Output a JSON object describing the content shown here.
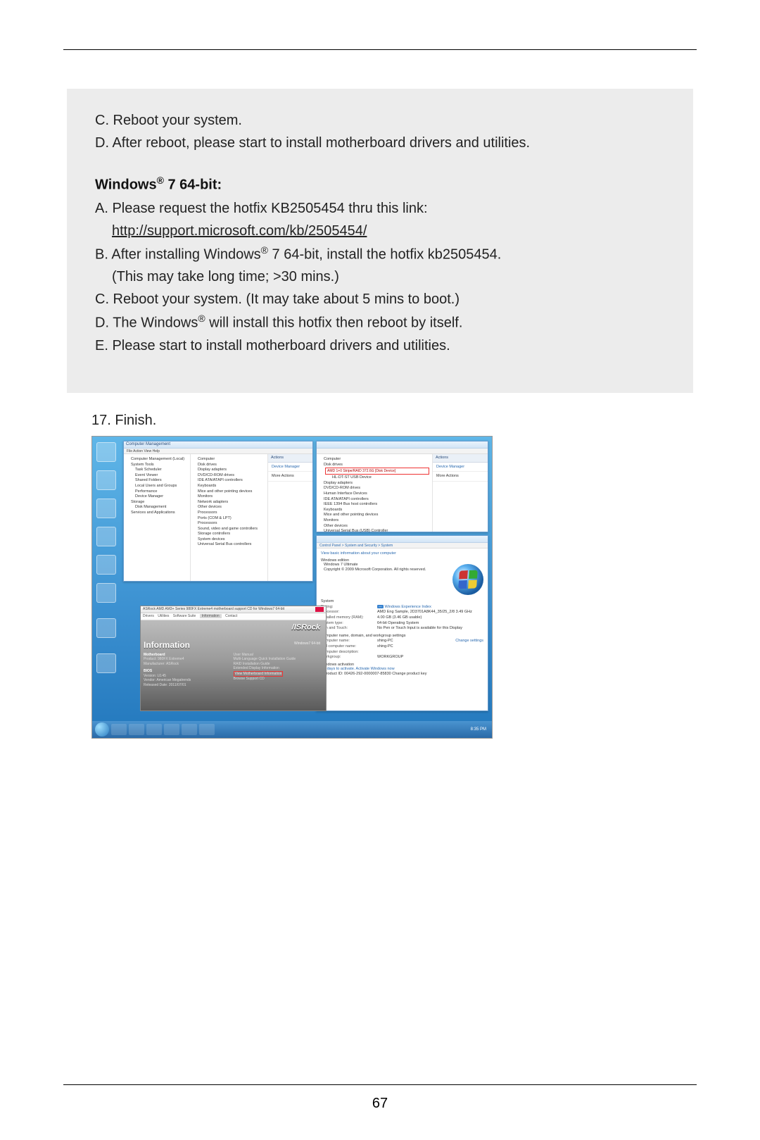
{
  "top_section": {
    "lineC": "C. Reboot your system.",
    "lineD": "D. After reboot, please start to install motherboard drivers and utilities."
  },
  "win64": {
    "heading_pre": "Windows",
    "heading_post": " 7 64-bit:",
    "A_pre": "A. Please request the hotfix KB2505454 thru this link:",
    "A_link": "http://support.microsoft.com/kb/2505454/",
    "B_pre": "B. After installing Windows",
    "B_post": " 7 64-bit, install the hotfix kb2505454.",
    "B_note": "(This may take long time; >30 mins.)",
    "C": "C. Reboot your system. (It may take about 5 mins to boot.)",
    "D_pre": "D. The Windows",
    "D_post": " will install this hotfix then reboot by itself.",
    "E": "E. Please start to install motherboard drivers and utilities."
  },
  "step17": "17. Finish.",
  "page_number": "67",
  "screenshot": {
    "taskbar_clock": "8:35 PM",
    "cm_window": {
      "title": "Computer Management",
      "menubar": "File  Action  View  Help",
      "left_tree": [
        "Computer Management (Local)",
        "System Tools",
        "Task Scheduler",
        "Event Viewer",
        "Shared Folders",
        "Local Users and Groups",
        "Performance",
        "Device Manager",
        "Storage",
        "Disk Management",
        "Services and Applications"
      ],
      "mid_tree": [
        "Computer",
        "Disk drives",
        "Display adapters",
        "DVD/CD-ROM drives",
        "IDE ATA/ATAPI controllers",
        "Keyboards",
        "Mice and other pointing devices",
        "Monitors",
        "Network adapters",
        "Other devices",
        "Processors",
        "Ports (COM & LPT)",
        "Processors",
        "Sound, video and game controllers",
        "Storage controllers",
        "System devices",
        "Universal Serial Bus controllers"
      ],
      "actions": "Actions",
      "actions_sub": "Device Manager",
      "actions_more": "More Actions"
    },
    "dm_window": {
      "mid_tree": [
        "Computer",
        "Disk drives",
        "AMD 1+0 Stripe/RAID 372.6G [Disk Device]",
        "HL-DT-ST USB Device",
        "Display adapters",
        "DVD/CD-ROM drives",
        "Human Interface Devices",
        "IDE ATA/ATAPI controllers",
        "IEEE 1394 Bus host controllers",
        "Keyboards",
        "Mice and other pointing devices",
        "Monitors",
        "Other devices",
        "Universal Serial Bus (USB) Controller"
      ],
      "actions": "Actions",
      "actions_sub": "Device Manager",
      "actions_more": "More Actions"
    },
    "sys_window": {
      "breadcrumb": "Control Panel > System and Security > System",
      "view_label": "View basic information about your computer",
      "edition_h": "Windows edition",
      "edition": "Windows 7 Ultimate",
      "copyright": "Copyright © 2009 Microsoft Corporation. All rights reserved.",
      "system_h": "System",
      "rating_k": "Rating:",
      "rating_v": "Windows Experience Index",
      "processor_k": "Processor:",
      "processor_v": "AMD Eng Sample, 2D3701A8K44_35/25_2/8    3.49 GHz",
      "ram_k": "Installed memory (RAM):",
      "ram_v": "4.00 GB (3.46 GB usable)",
      "systype_k": "System type:",
      "systype_v": "64-bit Operating System",
      "pen_k": "Pen and Touch:",
      "pen_v": "No Pen or Touch Input is available for this Display",
      "cname_h": "Computer name, domain, and workgroup settings",
      "cname_k": "Computer name:",
      "cname_v": "shing-PC",
      "change": "Change settings",
      "fname_k": "Full computer name:",
      "fname_v": "shing-PC",
      "desc_k": "Computer description:",
      "wg_k": "Workgroup:",
      "wg_v": "WORKGROUP",
      "act_h": "Windows activation",
      "act_line": "3 days to activate. Activate Windows now",
      "pid": "Product ID: 00426-292-0000007-85830   Change product key"
    },
    "info_app": {
      "title": "ASRock AMD AM3+ Series 980FX Extreme4 motherboard support CD for Windows7 64-bit",
      "tabs": [
        "Drivers",
        "Utilities",
        "Software Suite",
        "Information",
        "Contact"
      ],
      "brand": "/ISRock",
      "subbrand": "Windows7 64-bit",
      "heading": "Information",
      "left_block": {
        "mb_label": "Motherboard",
        "mb_val": "Product: 980FX Extreme4",
        "mf": "Manufacturer: ASRock",
        "bios_label": "BIOS",
        "bios_ver": "Version: L0.45",
        "bios_vendor": "Vendor: American Megatrends",
        "bios_date": "Released Date: 2011/07/01"
      },
      "right_block": {
        "um": "User Manual",
        "mlg": "Multi-Language Quick Installation Guide",
        "raid": "RAID Installation Guide",
        "edi": "Extended Display Information",
        "view_mb": "View Motherboard Information",
        "browse": "Browse Support CD"
      }
    }
  }
}
